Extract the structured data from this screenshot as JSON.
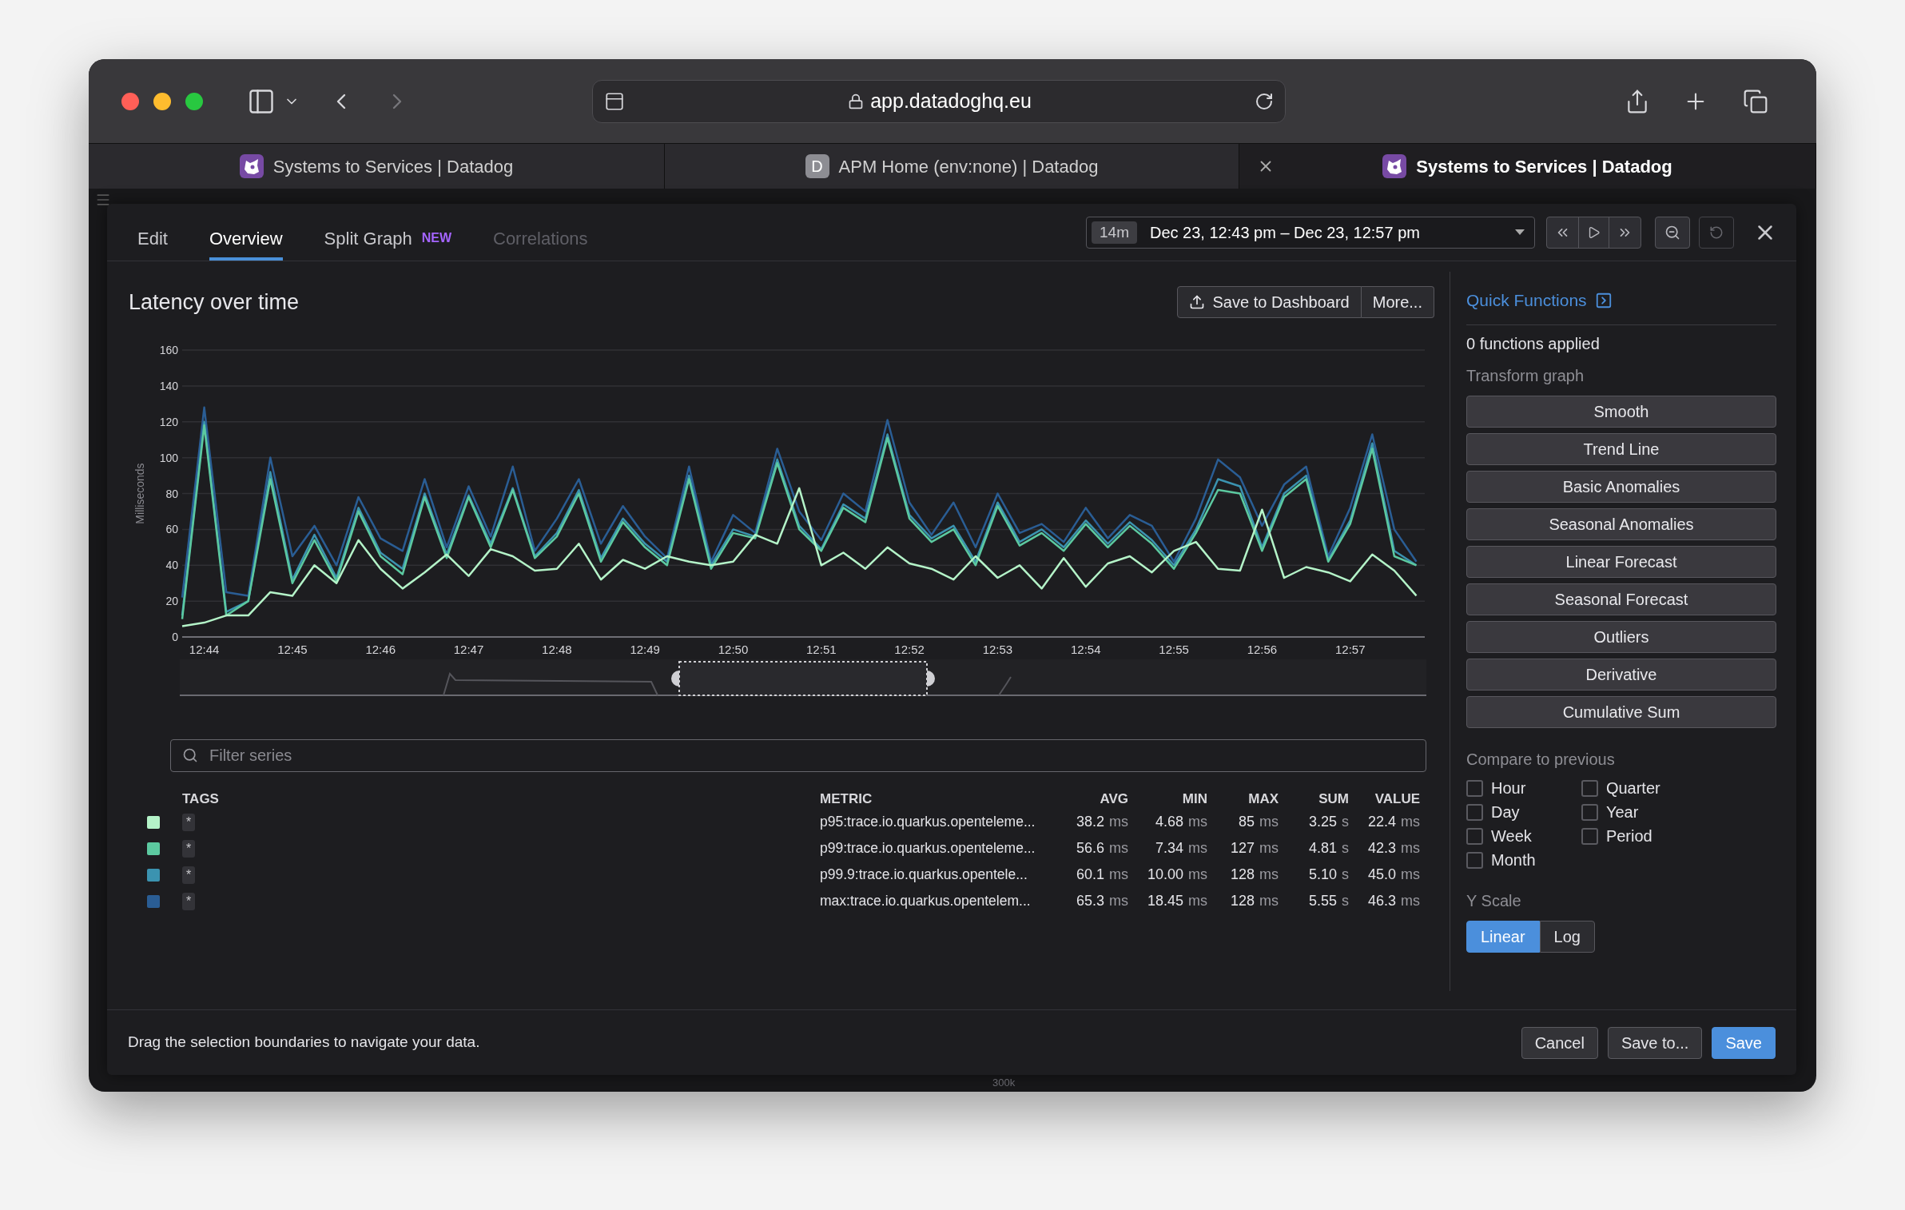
{
  "browser": {
    "address": "app.datadoghq.eu",
    "tabs": [
      {
        "title": "Systems to Services | Datadog",
        "kind": "logo",
        "selected": false
      },
      {
        "title": "APM Home (env:none) | Datadog",
        "kind": "letter",
        "letter": "D",
        "selected": false
      },
      {
        "title": "Systems to Services | Datadog",
        "kind": "logo",
        "selected": true
      }
    ]
  },
  "editor": {
    "tabs": [
      {
        "label": "Edit",
        "selected": false,
        "disabled": false
      },
      {
        "label": "Overview",
        "selected": true,
        "disabled": false
      },
      {
        "label": "Split Graph",
        "badge": "NEW",
        "selected": false,
        "disabled": false
      },
      {
        "label": "Correlations",
        "selected": false,
        "disabled": true
      }
    ],
    "timeframe": {
      "duration": "14m",
      "range": "Dec 23, 12:43 pm – Dec 23, 12:57 pm"
    }
  },
  "graph": {
    "title": "Latency over time",
    "actions": [
      "Save to Dashboard",
      "More..."
    ],
    "chart_data": {
      "type": "line",
      "grid": true,
      "ylabel": "Milliseconds",
      "ylim": [
        0,
        160
      ],
      "yticks": [
        0,
        20,
        40,
        60,
        80,
        100,
        120,
        140,
        160
      ],
      "categories": [
        null,
        "12:44",
        null,
        null,
        null,
        "12:45",
        null,
        null,
        null,
        "12:46",
        null,
        null,
        null,
        "12:47",
        null,
        null,
        null,
        "12:48",
        null,
        null,
        null,
        "12:49",
        null,
        null,
        null,
        "12:50",
        null,
        null,
        null,
        "12:51",
        null,
        null,
        null,
        "12:52",
        null,
        null,
        null,
        "12:53",
        null,
        null,
        null,
        "12:54",
        null,
        null,
        null,
        "12:55",
        null,
        null,
        null,
        "12:56",
        null,
        null,
        null,
        "12:57",
        null,
        null,
        null
      ],
      "series": [
        {
          "color": "#2a5d94",
          "values": [
            22,
            128,
            25,
            23,
            100,
            45,
            62,
            40,
            78,
            55,
            48,
            88,
            50,
            84,
            56,
            95,
            48,
            66,
            88,
            52,
            73,
            56,
            44,
            95,
            42,
            68,
            58,
            105,
            70,
            54,
            80,
            70,
            121,
            75,
            57,
            75,
            50,
            80,
            58,
            63,
            53,
            72,
            55,
            68,
            62,
            42,
            66,
            99,
            89,
            62,
            85,
            95,
            45,
            72,
            113,
            60,
            42
          ]
        },
        {
          "color": "#3b93b0",
          "values": [
            12,
            120,
            14,
            20,
            92,
            32,
            57,
            33,
            72,
            47,
            38,
            80,
            46,
            79,
            52,
            83,
            45,
            58,
            82,
            44,
            66,
            52,
            42,
            90,
            40,
            60,
            56,
            99,
            62,
            49,
            74,
            66,
            113,
            68,
            55,
            62,
            42,
            75,
            53,
            60,
            50,
            65,
            52,
            64,
            54,
            40,
            60,
            88,
            84,
            50,
            80,
            90,
            43,
            65,
            108,
            48,
            40
          ]
        },
        {
          "color": "#5cc9a0",
          "values": [
            10,
            118,
            12,
            20,
            88,
            30,
            54,
            31,
            70,
            45,
            35,
            78,
            44,
            78,
            50,
            82,
            44,
            56,
            80,
            42,
            64,
            50,
            40,
            88,
            38,
            58,
            55,
            97,
            60,
            48,
            72,
            64,
            111,
            66,
            53,
            60,
            40,
            73,
            51,
            58,
            48,
            63,
            50,
            62,
            52,
            38,
            58,
            82,
            80,
            48,
            78,
            88,
            42,
            63,
            105,
            45,
            40
          ]
        },
        {
          "color": "#b4f3c8",
          "values": [
            6,
            8,
            12,
            12,
            25,
            23,
            40,
            30,
            54,
            38,
            27,
            36,
            46,
            34,
            49,
            45,
            37,
            38,
            52,
            32,
            43,
            38,
            45,
            42,
            40,
            42,
            57,
            52,
            83,
            40,
            47,
            38,
            50,
            41,
            38,
            32,
            45,
            33,
            40,
            27,
            44,
            28,
            41,
            45,
            36,
            48,
            53,
            38,
            37,
            71,
            33,
            39,
            36,
            31,
            46,
            37,
            23
          ]
        }
      ]
    },
    "filter": {
      "placeholder": "Filter series"
    },
    "legend": {
      "columns": [
        "TAGS",
        "METRIC",
        "AVG",
        "MIN",
        "MAX",
        "SUM",
        "VALUE"
      ],
      "rows": [
        {
          "color": "#b4f3c8",
          "tag": "*",
          "metric": "p95:trace.io.quarkus.openteleme...",
          "stats": [
            {
              "v": "38.2",
              "u": "ms"
            },
            {
              "v": "4.68",
              "u": "ms"
            },
            {
              "v": "85",
              "u": "ms"
            },
            {
              "v": "3.25",
              "u": "s"
            },
            {
              "v": "22.4",
              "u": "ms"
            }
          ]
        },
        {
          "color": "#5cc9a0",
          "tag": "*",
          "metric": "p99:trace.io.quarkus.openteleme...",
          "stats": [
            {
              "v": "56.6",
              "u": "ms"
            },
            {
              "v": "7.34",
              "u": "ms"
            },
            {
              "v": "127",
              "u": "ms"
            },
            {
              "v": "4.81",
              "u": "s"
            },
            {
              "v": "42.3",
              "u": "ms"
            }
          ]
        },
        {
          "color": "#3b93b0",
          "tag": "*",
          "metric": "p99.9:trace.io.quarkus.opentele...",
          "stats": [
            {
              "v": "60.1",
              "u": "ms"
            },
            {
              "v": "10.00",
              "u": "ms"
            },
            {
              "v": "128",
              "u": "ms"
            },
            {
              "v": "5.10",
              "u": "s"
            },
            {
              "v": "45.0",
              "u": "ms"
            }
          ]
        },
        {
          "color": "#2a5d94",
          "tag": "*",
          "metric": "max:trace.io.quarkus.opentelem...",
          "stats": [
            {
              "v": "65.3",
              "u": "ms"
            },
            {
              "v": "18.45",
              "u": "ms"
            },
            {
              "v": "128",
              "u": "ms"
            },
            {
              "v": "5.55",
              "u": "s"
            },
            {
              "v": "46.3",
              "u": "ms"
            }
          ]
        }
      ]
    }
  },
  "quick_functions": {
    "title": "Quick Functions",
    "applied": "0 functions applied",
    "transform_label": "Transform graph",
    "transforms": [
      "Smooth",
      "Trend Line",
      "Basic Anomalies",
      "Seasonal Anomalies",
      "Linear Forecast",
      "Seasonal Forecast",
      "Outliers",
      "Derivative",
      "Cumulative Sum"
    ],
    "compare_label": "Compare to previous",
    "compare": [
      {
        "label": "Hour",
        "checked": false
      },
      {
        "label": "Day",
        "checked": false
      },
      {
        "label": "Week",
        "checked": false
      },
      {
        "label": "Month",
        "checked": false
      },
      {
        "label": "Quarter",
        "checked": false
      },
      {
        "label": "Year",
        "checked": false
      },
      {
        "label": "Period",
        "checked": false
      }
    ],
    "yscale_label": "Y Scale",
    "yscale": [
      {
        "label": "Linear",
        "selected": true
      },
      {
        "label": "Log",
        "selected": false
      }
    ]
  },
  "footer": {
    "hint": "Drag the selection boundaries to navigate your data.",
    "buttons": [
      {
        "label": "Cancel",
        "kind": "secondary"
      },
      {
        "label": "Save to...",
        "kind": "secondary"
      },
      {
        "label": "Save",
        "kind": "primary"
      }
    ]
  },
  "background_label": "300k"
}
